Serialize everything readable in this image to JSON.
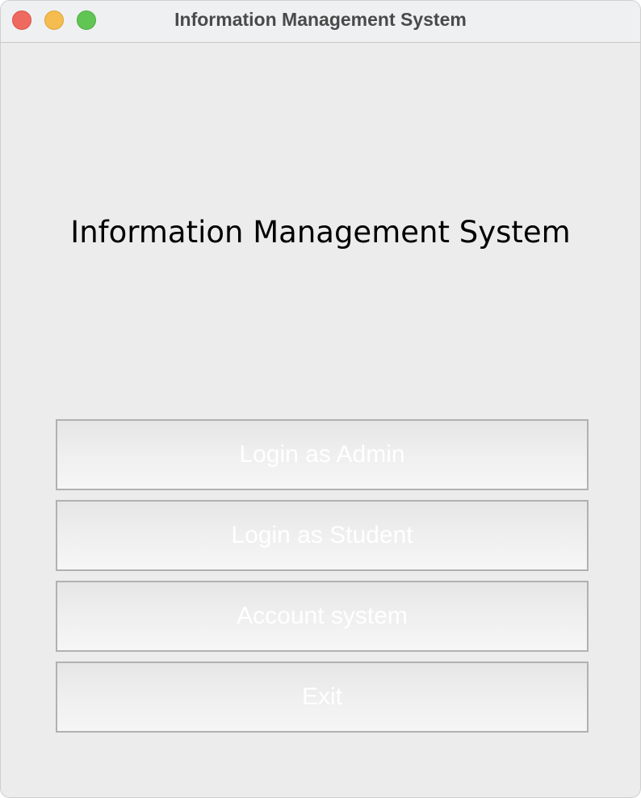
{
  "window": {
    "title": "Information Management System"
  },
  "main": {
    "heading": "Information Management System",
    "buttons": [
      {
        "label": "Login as Admin"
      },
      {
        "label": "Login as Student"
      },
      {
        "label": "Account system"
      },
      {
        "label": "Exit"
      }
    ]
  },
  "colors": {
    "background": "#ececec",
    "titlebar": "#eff0f2",
    "button_border": "#b1b1b1",
    "button_text": "#ffffff",
    "traffic_close": "#ee6a5f",
    "traffic_minimize": "#f5bd4f",
    "traffic_maximize": "#61c554"
  }
}
